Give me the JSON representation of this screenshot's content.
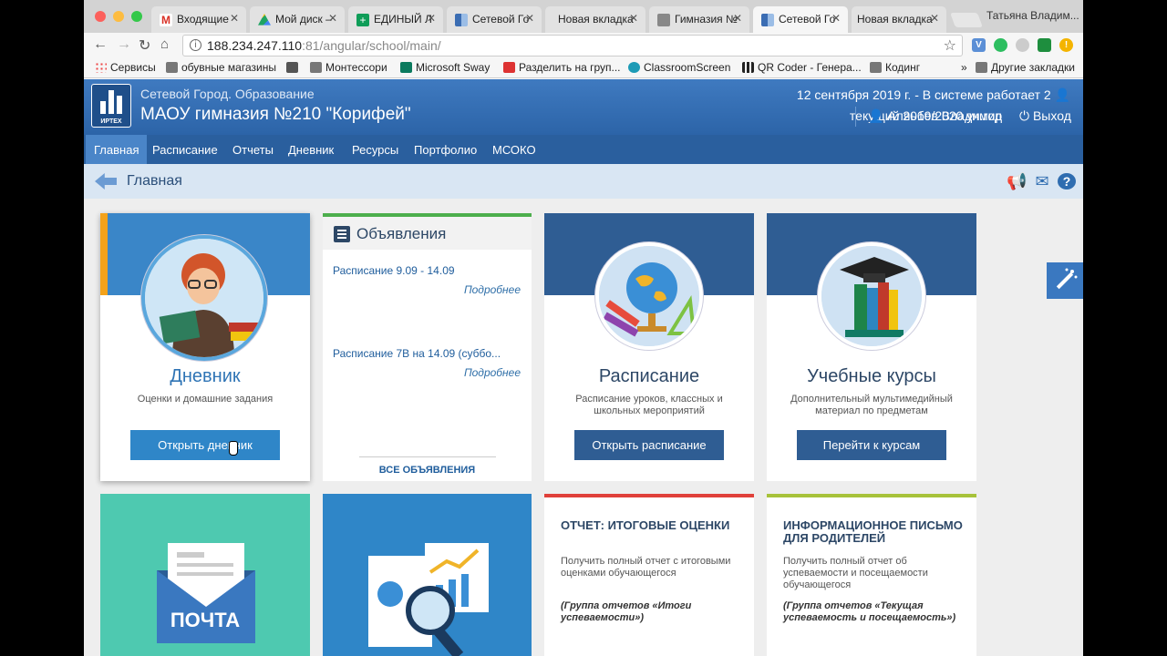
{
  "browser": {
    "tabs": [
      {
        "label": "Входящие",
        "favicon_color": "#d93025"
      },
      {
        "label": "Мой диск –",
        "favicon_color": "#1fa463"
      },
      {
        "label": "ЕДИНЫЙ Л",
        "favicon_color": "#0f9d58"
      },
      {
        "label": "Сетевой Го",
        "favicon_color": "#3b6db3"
      },
      {
        "label": "Новая вкладка",
        "favicon_color": ""
      },
      {
        "label": "Гимназия №",
        "favicon_color": "#666666"
      },
      {
        "label": "Сетевой Го",
        "favicon_color": "#3b6db3"
      },
      {
        "label": "Новая вкладка",
        "favicon_color": ""
      }
    ],
    "active_tab_index": 6,
    "profile_name": "Татьяна Владим...",
    "url_host": "188.234.247.110",
    "url_rest": ":81/angular/school/main/",
    "bookmarks": [
      {
        "label": "Сервисы",
        "icon": "apps-icon"
      },
      {
        "label": "обувные магазины",
        "icon": "folder-icon"
      },
      {
        "label": "",
        "icon": "site-icon"
      },
      {
        "label": "Монтессори",
        "icon": "folder-icon"
      },
      {
        "label": "Microsoft Sway",
        "icon": "sway-icon"
      },
      {
        "label": "Разделить на груп...",
        "icon": "site-icon"
      },
      {
        "label": "ClassroomScreen",
        "icon": "classroom-icon"
      },
      {
        "label": "QR Coder - Генера...",
        "icon": "qr-icon"
      },
      {
        "label": "Кодинг",
        "icon": "folder-icon"
      }
    ],
    "other_bookmarks": "Другие закладки",
    "overflow_chevron": "»"
  },
  "header": {
    "system_name": "Сетевой Город. Образование",
    "school_name": "МАОУ гимназия №210 \"Корифей\"",
    "date_status": "12 сентября 2019 г. - В системе работает 2",
    "school_year": "текущий 2019/2020 уч.год",
    "user_name": "Аляьбев Владимир",
    "logout": "Выход",
    "logo_text": "ИРТЕХ"
  },
  "nav": [
    "Главная",
    "Расписание",
    "Отчеты",
    "Дневник",
    "Ресурсы",
    "Портфолио",
    "МСОКО"
  ],
  "nav_active": 0,
  "breadcrumb": {
    "title": "Главная"
  },
  "cards": {
    "diary": {
      "title": "Дневник",
      "subtitle": "Оценки и домашние задания",
      "button": "Открыть дневник"
    },
    "schedule": {
      "title": "Расписание",
      "subtitle": "Расписание уроков, классных и школьных мероприятий",
      "button": "Открыть расписание"
    },
    "courses": {
      "title": "Учебные курсы",
      "subtitle": "Дополнительный мультимедийный материал по предметам",
      "button": "Перейти к курсам"
    }
  },
  "announcements": {
    "title": "Объявления",
    "items": [
      {
        "text": "Расписание 9.09 - 14.09",
        "more": "Подробнее"
      },
      {
        "text": "Расписание 7В на 14.09 (суббо...",
        "more": "Подробнее"
      }
    ],
    "all_link": "ВСЕ ОБЪЯВЛЕНИЯ"
  },
  "mail_tile": {
    "label": "ПОЧТА"
  },
  "reports": [
    {
      "title": "ОТЧЕТ: ИТОГОВЫЕ ОЦЕНКИ",
      "desc": "Получить полный отчет с итоговыми оценками обучающегося",
      "group": "(Группа отчетов «Итоги успеваемости»)",
      "accent": "#e0403a"
    },
    {
      "title": "ИНФОРМАЦИОННОЕ ПИСЬМО ДЛЯ РОДИТЕЛЕЙ",
      "desc": "Получить полный отчет об успеваемости и посещаемости обучающегося",
      "group": "(Группа отчетов «Текущая успеваемость и посещаемость»)",
      "accent": "#a7c23a"
    }
  ],
  "colors": {
    "brand": "#2f5d93",
    "nav": "#2a5f9e",
    "accent_orange": "#f3a21b",
    "teal": "#4ec9b0"
  }
}
